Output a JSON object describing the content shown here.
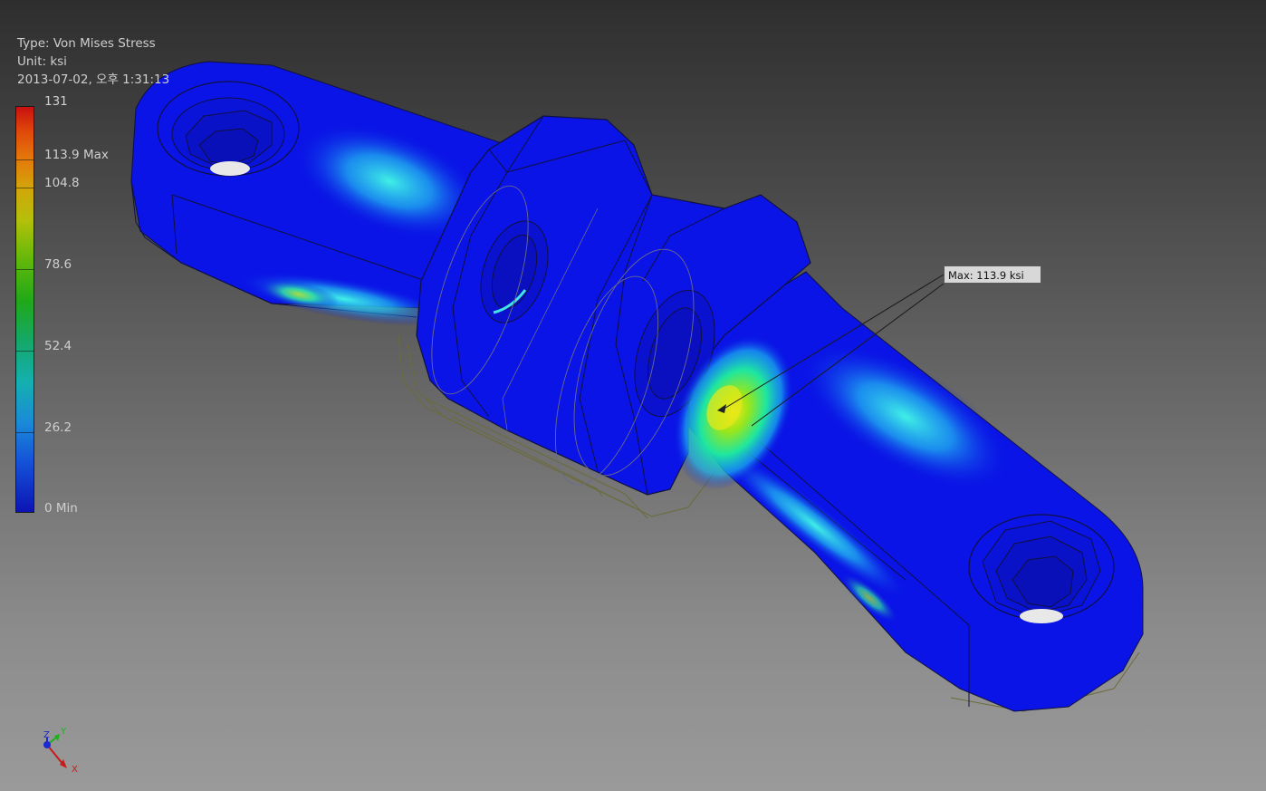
{
  "info": {
    "type_line": "Type: Von Mises Stress",
    "unit_line": "Unit: ksi",
    "date_line": "2013-07-02, 오후 1:31:13"
  },
  "legend": {
    "labels": [
      "131",
      "113.9 Max",
      "104.8",
      "78.6",
      "52.4",
      "26.2",
      "0 Min"
    ],
    "max_value": 131,
    "min_value": 0
  },
  "callout": {
    "text": "Max: 113.9 ksi"
  },
  "triad": {
    "x_label": "X",
    "y_label": "Y",
    "z_label": "Z"
  },
  "colors": {
    "part_base": "#0a14e6",
    "edge_line": "#101040",
    "ghost_outline": "#6b6b3a",
    "high_stress": "#e6e61a",
    "mid_stress": "#1ee6c8"
  }
}
